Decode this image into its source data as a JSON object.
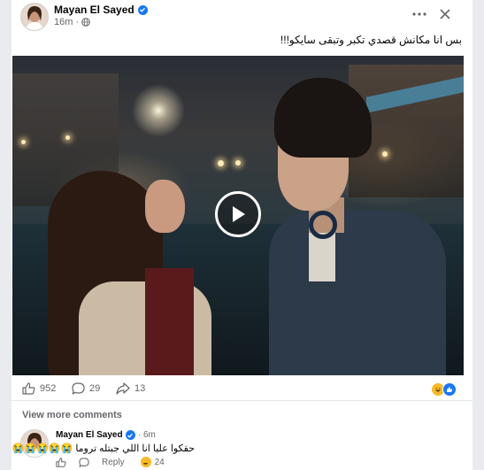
{
  "post": {
    "author": "Mayan El Sayed",
    "time": "16m",
    "text": "بس انا مكانش قصدي تكبر وتبقى سايكو!!!"
  },
  "stats": {
    "likes": "952",
    "comments": "29",
    "shares": "13"
  },
  "view_more_comments": "View more comments",
  "comment": {
    "author": "Mayan El Sayed",
    "time": "6m",
    "text": "حقكوا عليا انا اللي جبتله تروما 😭😭😭😭😭😭😭😭",
    "reply_label": "Reply",
    "reaction_count": "24"
  },
  "icons": {
    "avatar": "avatar",
    "verified": "verified-badge-icon",
    "globe": "globe-icon",
    "more": "more-options-icon",
    "close": "close-icon",
    "play": "play-icon",
    "like": "like-icon",
    "comment": "comment-icon",
    "share": "share-icon"
  },
  "colors": {
    "accent": "#1877f2",
    "secondary_text": "#65676b"
  }
}
